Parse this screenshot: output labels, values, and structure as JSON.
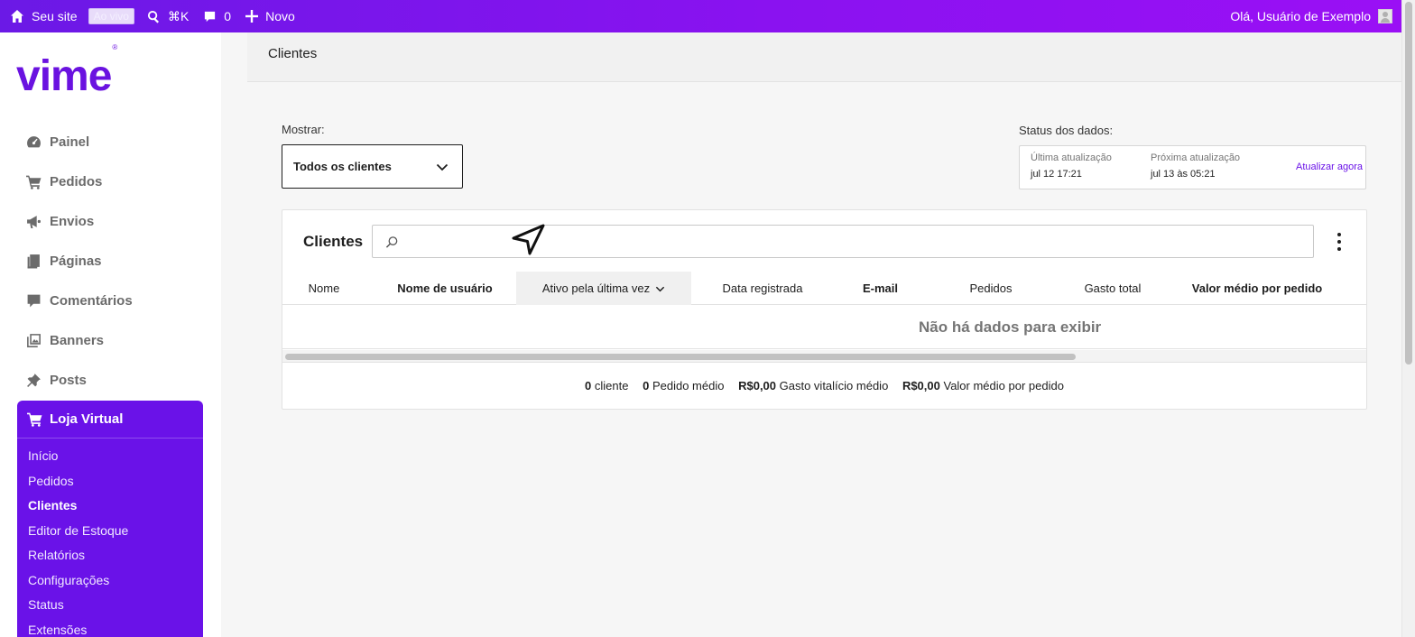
{
  "adminbar": {
    "site_label": "Seu site",
    "live_badge": "Ao vivo",
    "search_shortcut": "⌘K",
    "comments_count": "0",
    "new_label": "Novo",
    "greeting": "Olá, Usuário de Exemplo"
  },
  "brand": {
    "logo_text": "vime",
    "logo_mark": "®",
    "color": "#6a12e8"
  },
  "sidebar": {
    "items": [
      {
        "label": "Painel",
        "icon": "dashboard-icon"
      },
      {
        "label": "Pedidos",
        "icon": "cart-icon"
      },
      {
        "label": "Envios",
        "icon": "megaphone-icon"
      },
      {
        "label": "Páginas",
        "icon": "pages-icon"
      },
      {
        "label": "Comentários",
        "icon": "comment-icon"
      },
      {
        "label": "Banners",
        "icon": "media-icon"
      },
      {
        "label": "Posts",
        "icon": "pin-icon"
      }
    ],
    "store": {
      "title": "Loja Virtual",
      "items": [
        "Início",
        "Pedidos",
        "Clientes",
        "Editor de Estoque",
        "Relatórios",
        "Configurações",
        "Status",
        "Extensões"
      ],
      "active": "Clientes"
    }
  },
  "page": {
    "title": "Clientes"
  },
  "filter": {
    "label": "Mostrar:",
    "value": "Todos os clientes"
  },
  "status": {
    "label": "Status dos dados:",
    "last_label": "Última atualização",
    "last_value": "jul 12 17:21",
    "next_label": "Próxima atualização",
    "next_value": "jul 13 às 05:21",
    "refresh_label": "Atualizar agora"
  },
  "table": {
    "title": "Clientes",
    "search_placeholder": "",
    "columns": [
      "Nome",
      "Nome de usuário",
      "Ativo pela última vez",
      "Data registrada",
      "E-mail",
      "Pedidos",
      "Gasto total",
      "Valor médio por pedido"
    ],
    "sorted_column": "Ativo pela última vez",
    "empty_message": "Não há dados para exibir"
  },
  "summary": {
    "customers_value": "0",
    "customers_label": "cliente",
    "avg_orders_value": "0",
    "avg_orders_label": "Pedido médio",
    "avg_lifetime_value": "R$0,00",
    "avg_lifetime_label": "Gasto vitalício médio",
    "avg_order_value": "R$0,00",
    "avg_order_label": "Valor médio por pedido"
  }
}
